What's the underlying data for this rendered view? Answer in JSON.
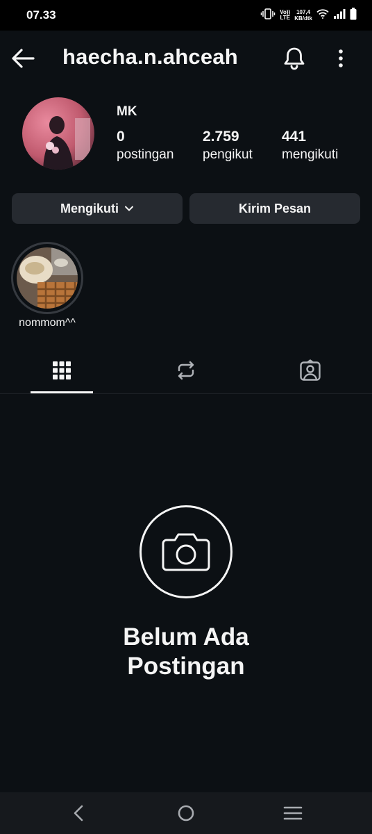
{
  "status_bar": {
    "time": "07.33",
    "volte_line1": "Vo))",
    "volte_line2": "LTE",
    "speed_value": "107,4",
    "speed_unit": "KB/dtk",
    "icons": [
      "vibrate-icon",
      "volte-icon",
      "wifi-icon",
      "signal-icon",
      "battery-icon"
    ]
  },
  "header": {
    "username": "haecha.n.ahceah",
    "icons": [
      "back-arrow-icon",
      "bell-icon",
      "more-vertical-icon"
    ]
  },
  "profile": {
    "display_name": "MK",
    "stats": [
      {
        "value": "0",
        "label": "postingan"
      },
      {
        "value": "2.759",
        "label": "pengikut"
      },
      {
        "value": "441",
        "label": "mengikuti"
      }
    ]
  },
  "actions": {
    "following_label": "Mengikuti",
    "message_label": "Kirim Pesan"
  },
  "highlights": [
    {
      "label": "nommom^^"
    }
  ],
  "tabs": [
    "grid-icon",
    "reposts-icon",
    "tagged-icon"
  ],
  "empty_state": {
    "icon": "camera-icon",
    "title_line1": "Belum Ada",
    "title_line2": "Postingan"
  },
  "nav": [
    "back-icon",
    "home-icon",
    "menu-icon"
  ],
  "colors": {
    "background": "#0c1014",
    "button": "#262a30",
    "text": "#f5f5f5"
  }
}
